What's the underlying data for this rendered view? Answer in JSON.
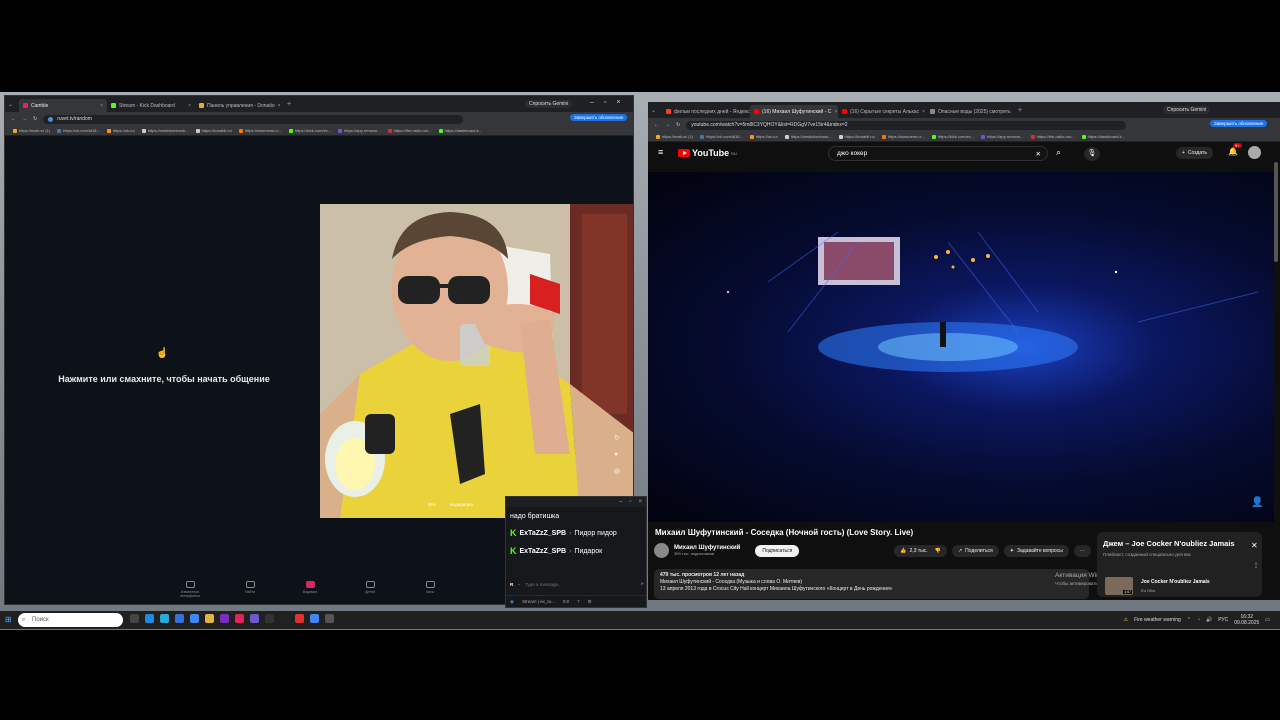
{
  "left_browser": {
    "tabs": [
      {
        "label": "Camble",
        "active": true
      },
      {
        "label": "Stream - Kick Dashboard",
        "active": false
      },
      {
        "label": "Панель управления - Donatio",
        "active": false
      }
    ],
    "gemini_label": "Спросить Gemini",
    "url": "ruvet.tv/random",
    "update_label": "Завершить обновление",
    "bookmarks": [
      "https://mail.ru/ (1)",
      "https://vk.com/id18...",
      "https://ok.ru/",
      "https://vestivkonbook...",
      "https://konabli.ru/",
      "https://www.temu.c...",
      "https://kick.com/ex...",
      "https://app.remove...",
      "https://the-radio.ru/r...",
      "https://dashboard.k..."
    ]
  },
  "chat_app": {
    "prompt": "Нажмите или смахните, чтобы начать общение",
    "cam_overlay": {
      "tags": [
        "Все",
        "модерация"
      ]
    },
    "nav": [
      "Изменения интерфейса",
      "Найти",
      "Видимое",
      "Детей",
      "Чаты"
    ]
  },
  "kick_chat": {
    "messages": [
      {
        "user": "",
        "text": "надо братишка"
      },
      {
        "user": "ExTaZzZ_SPB",
        "text": "Пидор пидор"
      },
      {
        "user": "ExTaZzZ_SPB",
        "text": "Пидарок"
      }
    ],
    "input_placeholder": "Type a message...",
    "footer": {
      "stream": "Stream | ex_to...",
      "time": "0:0",
      "count": "7"
    }
  },
  "right_browser": {
    "tabs": [
      {
        "label": "фильм последних дней - Яндекс",
        "active": false
      },
      {
        "label": "(16) Михаил Шуфутинский - С",
        "active": true
      },
      {
        "label": "(16) Скрытые секреты Алькас",
        "active": false
      },
      {
        "label": "Опасные воды (2025) смотреть",
        "active": false
      }
    ],
    "gemini_label": "Спросить Gemini",
    "url": "youtube.com/watch?v=5m8lC3YQHOY&list=RDGgV7ve15ir4&index=2",
    "update_label": "Завершить обновление",
    "bookmarks": [
      "https://mail.ru/ (1)",
      "https://vk.com/id18...",
      "https://ok.ru/",
      "https://vestivkonbook...",
      "https://konabli.ru/",
      "https://www.temu.c...",
      "https://kick.com/ex...",
      "https://app.remove...",
      "https://the-radio.ru/r...",
      "https://dashboard.k..."
    ]
  },
  "youtube": {
    "logo": "YouTube",
    "region": "RU",
    "search_value": "джо кокер",
    "create_label": "Создать",
    "notif_count": "9+",
    "video_title": "Михаил Шуфутинский - Соседка (Ночной гость) (Love Story. Live)",
    "channel": "Михаил Шуфутинский",
    "subscribers": "399 тыс. подписчиков",
    "subscribe_label": "Подписаться",
    "likes": "2,3 тыс.",
    "share_label": "Поделиться",
    "ask_label": "Задавайте вопросы",
    "desc_line1": "479 тыс. просмотров  12 лет назад",
    "desc_line2": "Михаил Шуфутинский - Соседка (Музыка и слова О. Митяев)",
    "desc_line3": "13 апреля 2013 года в Crocus City Hall концерт Михаила Шуфутинского «Концерт в День рождения»",
    "playlist_title": "Джем – Joe Cocker N'oubliez Jamais",
    "playlist_sub": "Плейлист, созданный специально для вас",
    "playlist_item": "Joe Cocker N'oubliez Jamais",
    "playlist_item_by": "Ed Olhs",
    "playlist_item_time": "4:57",
    "windows_watermark": "Активация Windows",
    "windows_watermark_sub": "Чтобы активировать Windows..."
  },
  "taskbar": {
    "search_placeholder": "Поиск",
    "weather": "Fire weather warning",
    "lang": "РУС",
    "time": "16:32",
    "date": "09.08.2025"
  }
}
